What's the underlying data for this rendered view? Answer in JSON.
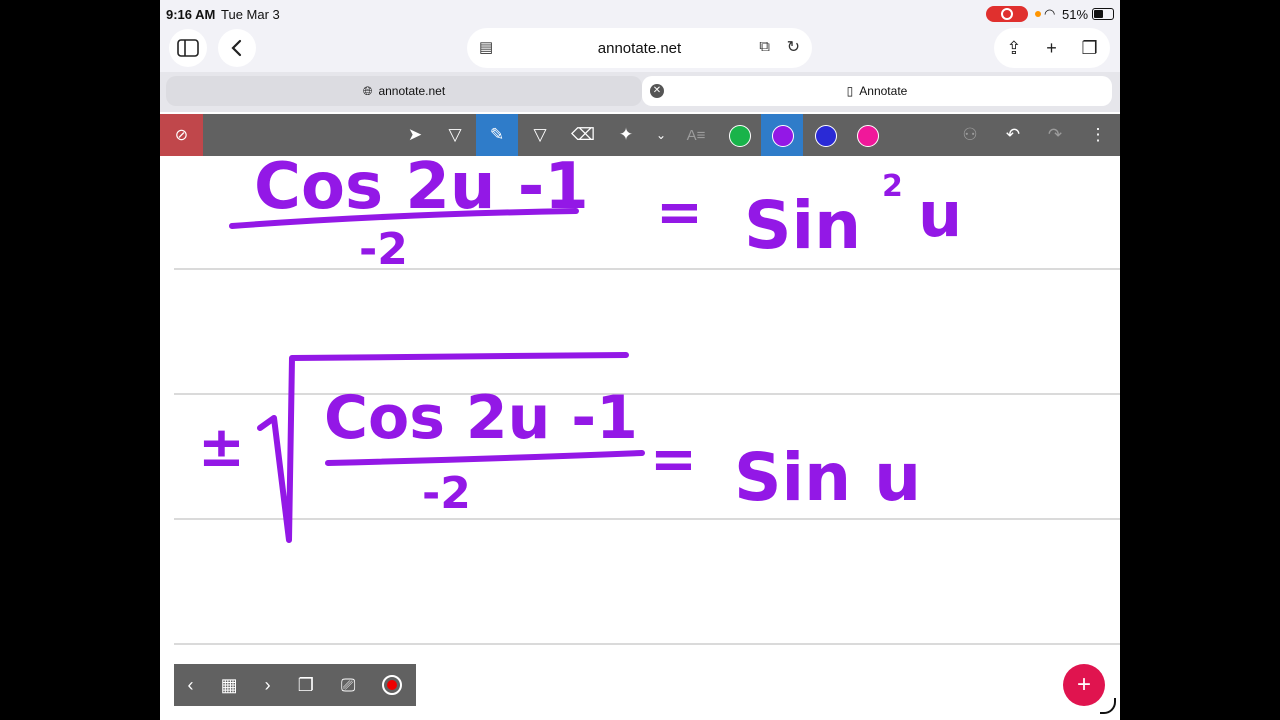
{
  "status_bar": {
    "time": "9:16 AM",
    "date": "Tue Mar 3",
    "battery": "51%"
  },
  "browser": {
    "url": "annotate.net",
    "tabs": [
      {
        "label": "annotate.net"
      },
      {
        "label": "Annotate"
      }
    ]
  },
  "annotate_toolbar": {
    "active_tool": "pen",
    "active_color": "#9318e6",
    "colors": [
      "#19b34a",
      "#9318e6",
      "#2a2ad6",
      "#f0189a"
    ]
  },
  "handwriting": {
    "eq1_numerator": "Cos 2u -1",
    "eq1_denominator": "-2",
    "eq1_rhs": "Sin",
    "eq1_rhs_exp": "2",
    "eq1_rhs_var": "u",
    "eq2_pm": "±",
    "eq2_numerator": "Cos 2u -1",
    "eq2_denominator": "-2",
    "eq2_rhs": "Sin u",
    "equals": "="
  },
  "ink_color": "#9318e6",
  "fab_label": "+"
}
